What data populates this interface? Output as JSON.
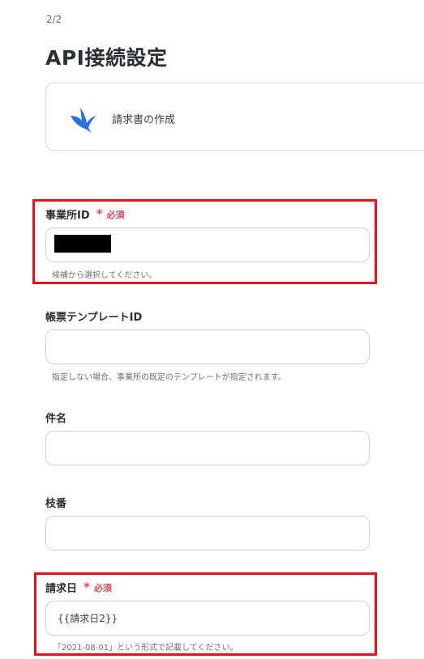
{
  "step_indicator": "2/2",
  "page_title": "API接続設定",
  "app": {
    "name": "請求書の作成",
    "icon": "swallow-bird-icon",
    "icon_color": "#2f6fe4"
  },
  "required_label": "必須",
  "accent_colors": {
    "required": "#e8475a",
    "highlight_border": "#e0141e"
  },
  "fields": {
    "office_id": {
      "label": "事業所ID",
      "required": true,
      "value": "",
      "hint": "候補から選択してください。"
    },
    "template_id": {
      "label": "帳票テンプレートID",
      "required": false,
      "value": "",
      "hint": "指定しない場合、事業所の既定のテンプレートが指定されます。"
    },
    "subject": {
      "label": "件名",
      "required": false,
      "value": ""
    },
    "branch_no": {
      "label": "枝番",
      "required": false,
      "value": ""
    },
    "billing_date": {
      "label": "請求日",
      "required": true,
      "value": "{{請求日2}}",
      "hint": "「2021-08-01」という形式で記載してください。"
    }
  }
}
